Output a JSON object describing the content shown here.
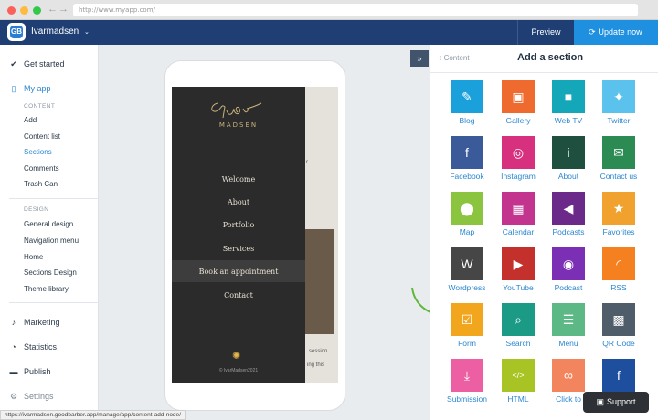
{
  "browser": {
    "url": "http://www.myapp.com/"
  },
  "topbar": {
    "app_name": "Ivarmadsen",
    "preview_label": "Preview",
    "update_label": "Update now"
  },
  "sidebar": {
    "get_started": "Get started",
    "my_app": "My app",
    "content_header": "CONTENT",
    "content_items": [
      "Add",
      "Content list",
      "Sections",
      "Comments",
      "Trash Can"
    ],
    "design_header": "DESIGN",
    "design_items": [
      "General design",
      "Navigation menu",
      "Home",
      "Sections Design",
      "Theme library"
    ],
    "marketing": "Marketing",
    "statistics": "Statistics",
    "publish": "Publish",
    "settings": "Settings"
  },
  "preview": {
    "menu_items": [
      "Welcome",
      "About",
      "Portfolio",
      "Services",
      "Book an appointment",
      "Contact"
    ],
    "copyright": "© IvarMadsen2021",
    "bg_snippets": [
      "r",
      "session",
      "ing this"
    ]
  },
  "panel": {
    "back_label": "Content",
    "title": "Add a section",
    "tiles": [
      {
        "label": "Blog",
        "icon": "pencil-icon",
        "color": "#1aa1dc",
        "glyph": "✎"
      },
      {
        "label": "Gallery",
        "icon": "image-icon",
        "color": "#ef6a2e",
        "glyph": "▣"
      },
      {
        "label": "Web TV",
        "icon": "video-icon",
        "color": "#14a7b9",
        "glyph": "■"
      },
      {
        "label": "Twitter",
        "icon": "twitter-icon",
        "color": "#5bc2ee",
        "glyph": "✦"
      },
      {
        "label": "Facebook",
        "icon": "facebook-icon",
        "color": "#3b5a9a",
        "glyph": "f"
      },
      {
        "label": "Instagram",
        "icon": "instagram-icon",
        "color": "#d6307f",
        "glyph": "◎"
      },
      {
        "label": "About",
        "icon": "info-icon",
        "color": "#1f4f3f",
        "glyph": "i"
      },
      {
        "label": "Contact us",
        "icon": "envelope-icon",
        "color": "#2b8b52",
        "glyph": "✉"
      },
      {
        "label": "Map",
        "icon": "map-pin-icon",
        "color": "#8bc43f",
        "glyph": "⬤"
      },
      {
        "label": "Calendar",
        "icon": "calendar-icon",
        "color": "#c2348e",
        "glyph": "▦"
      },
      {
        "label": "Podcasts",
        "icon": "speaker-icon",
        "color": "#6b2a8a",
        "glyph": "◀"
      },
      {
        "label": "Favorites",
        "icon": "star-icon",
        "color": "#f1a12e",
        "glyph": "★"
      },
      {
        "label": "Wordpress",
        "icon": "wordpress-icon",
        "color": "#464646",
        "glyph": "W"
      },
      {
        "label": "YouTube",
        "icon": "youtube-icon",
        "color": "#c4302b",
        "glyph": "▶"
      },
      {
        "label": "Podcast",
        "icon": "podcast-icon",
        "color": "#7b2fb5",
        "glyph": "◉"
      },
      {
        "label": "RSS",
        "icon": "rss-icon",
        "color": "#f4801f",
        "glyph": "◜"
      },
      {
        "label": "Form",
        "icon": "checkbox-icon",
        "color": "#f2a61d",
        "glyph": "☑"
      },
      {
        "label": "Search",
        "icon": "search-icon",
        "color": "#1b9a85",
        "glyph": "⌕"
      },
      {
        "label": "Menu",
        "icon": "list-icon",
        "color": "#5cb885",
        "glyph": "☰"
      },
      {
        "label": "QR Code",
        "icon": "qr-code-icon",
        "color": "#4f5d6b",
        "glyph": "▩"
      },
      {
        "label": "Submission",
        "icon": "download-icon",
        "color": "#ec5fa3",
        "glyph": "⤓"
      },
      {
        "label": "HTML",
        "icon": "code-icon",
        "color": "#a8c324",
        "glyph": "</>"
      },
      {
        "label": "Click to",
        "icon": "link-icon",
        "color": "#f2845e",
        "glyph": "∞"
      },
      {
        "label": "",
        "icon": "facebook-icon",
        "color": "#1e4f9f",
        "glyph": "f"
      }
    ]
  },
  "support_label": "Support",
  "status_url": "https://ivarmadsen.goodbarber.app/manage/app/content-add-node/"
}
